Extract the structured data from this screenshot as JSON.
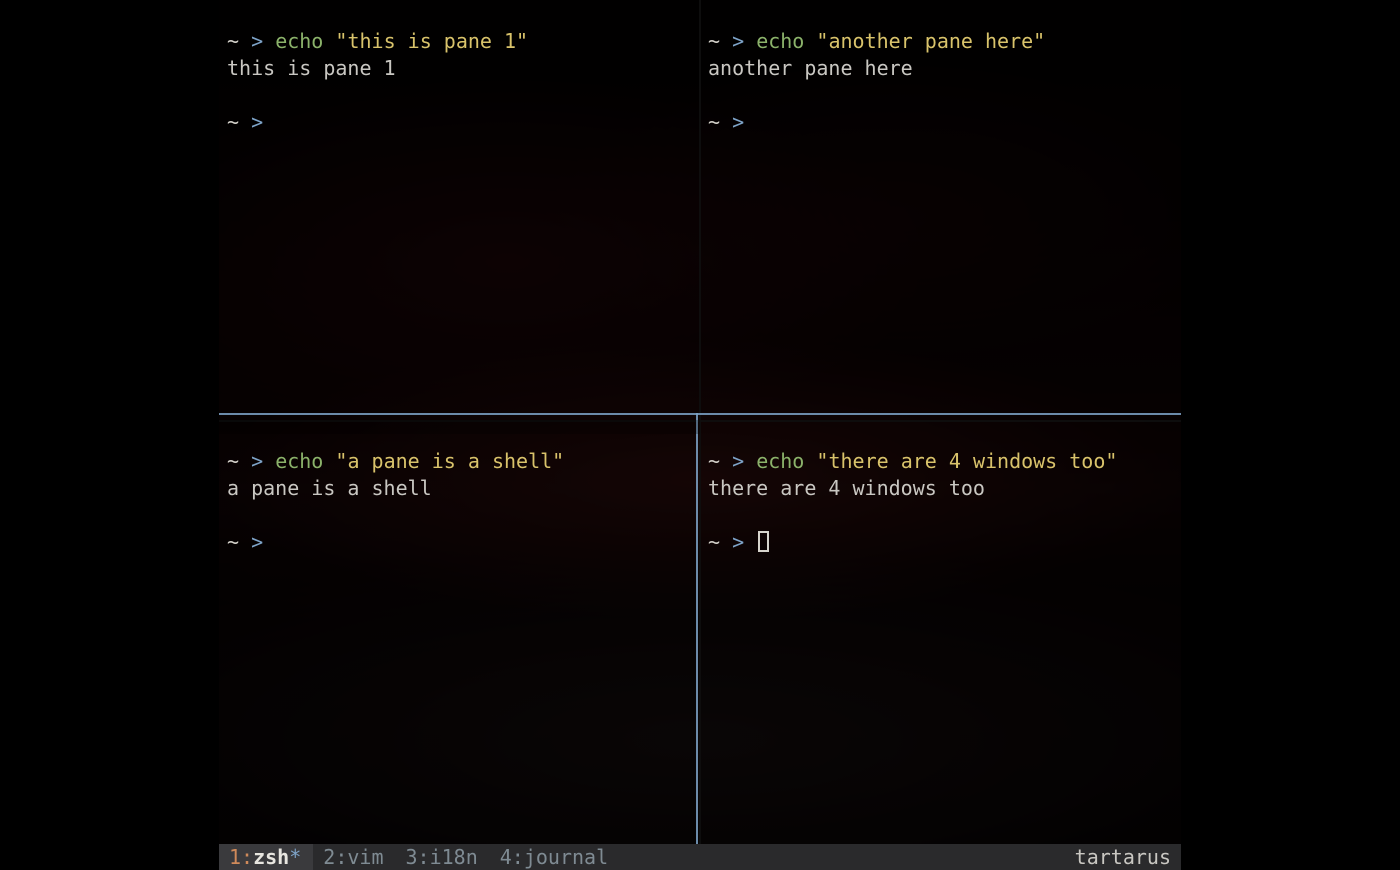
{
  "colors": {
    "prompt_gt": "#7ea3c8",
    "command": "#8bb26a",
    "string": "#d9c36b",
    "text": "#c9c7c2",
    "active_idx": "#d08a5a",
    "border": "#7ea3c8"
  },
  "panes": {
    "top_left": {
      "prompt_dir": "~",
      "prompt_sym": ">",
      "command": "echo",
      "argument": "\"this is pane 1\"",
      "output": "this is pane 1",
      "next_prompt_dir": "~",
      "next_prompt_sym": ">"
    },
    "top_right": {
      "prompt_dir": "~",
      "prompt_sym": ">",
      "command": "echo",
      "argument": "\"another pane here\"",
      "output": "another pane here",
      "next_prompt_dir": "~",
      "next_prompt_sym": ">"
    },
    "bottom_left": {
      "prompt_dir": "~",
      "prompt_sym": ">",
      "command": "echo",
      "argument": "\"a pane is a shell\"",
      "output": "a pane is a shell",
      "next_prompt_dir": "~",
      "next_prompt_sym": ">"
    },
    "bottom_right": {
      "prompt_dir": "~",
      "prompt_sym": ">",
      "command": "echo",
      "argument": "\"there are 4 windows too\"",
      "output": "there are 4 windows too",
      "next_prompt_dir": "~",
      "next_prompt_sym": ">",
      "has_cursor": true
    }
  },
  "active_pane": "bottom_right",
  "statusbar": {
    "windows": [
      {
        "index": "1",
        "sep": ":",
        "name": "zsh",
        "flag": "*",
        "active": true
      },
      {
        "index": "2",
        "sep": ":",
        "name": "vim",
        "flag": "",
        "active": false
      },
      {
        "index": "3",
        "sep": ":",
        "name": "i18n",
        "flag": "",
        "active": false
      },
      {
        "index": "4",
        "sep": ":",
        "name": "journal",
        "flag": "",
        "active": false
      }
    ],
    "hostname": "tartarus"
  }
}
